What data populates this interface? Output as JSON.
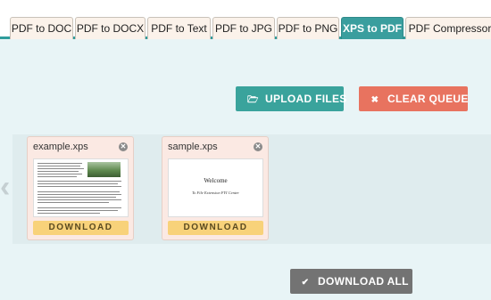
{
  "tabs": [
    {
      "label": "PDF to DOC",
      "active": false
    },
    {
      "label": "PDF to DOCX",
      "active": false
    },
    {
      "label": "PDF to Text",
      "active": false
    },
    {
      "label": "PDF to JPG",
      "active": false
    },
    {
      "label": "PDF to PNG",
      "active": false
    },
    {
      "label": "XPS to PDF",
      "active": true
    },
    {
      "label": "PDF Compressor",
      "active": false
    }
  ],
  "toolbar": {
    "upload_label": "UPLOAD FILES",
    "upload_icon": "folder-open-icon",
    "clear_label": "CLEAR QUEUE",
    "clear_icon": "x-icon"
  },
  "files": [
    {
      "name": "example.xps",
      "download_label": "DOWNLOAD",
      "thumb": "document-with-photo"
    },
    {
      "name": "sample.xps",
      "download_label": "DOWNLOAD",
      "thumb_title": "Welcome",
      "thumb_subtitle": "To File Extension FYI Center"
    }
  ],
  "footer": {
    "download_all_label": "DOWNLOAD ALL",
    "download_all_icon": "check-icon"
  },
  "colors": {
    "tab_active": "#3a9e9e",
    "upload_button": "#3aa39c",
    "clear_button": "#e8735f",
    "download_button": "#f8d27a",
    "download_all_button": "#737373",
    "card_background": "#fbe9e3"
  }
}
